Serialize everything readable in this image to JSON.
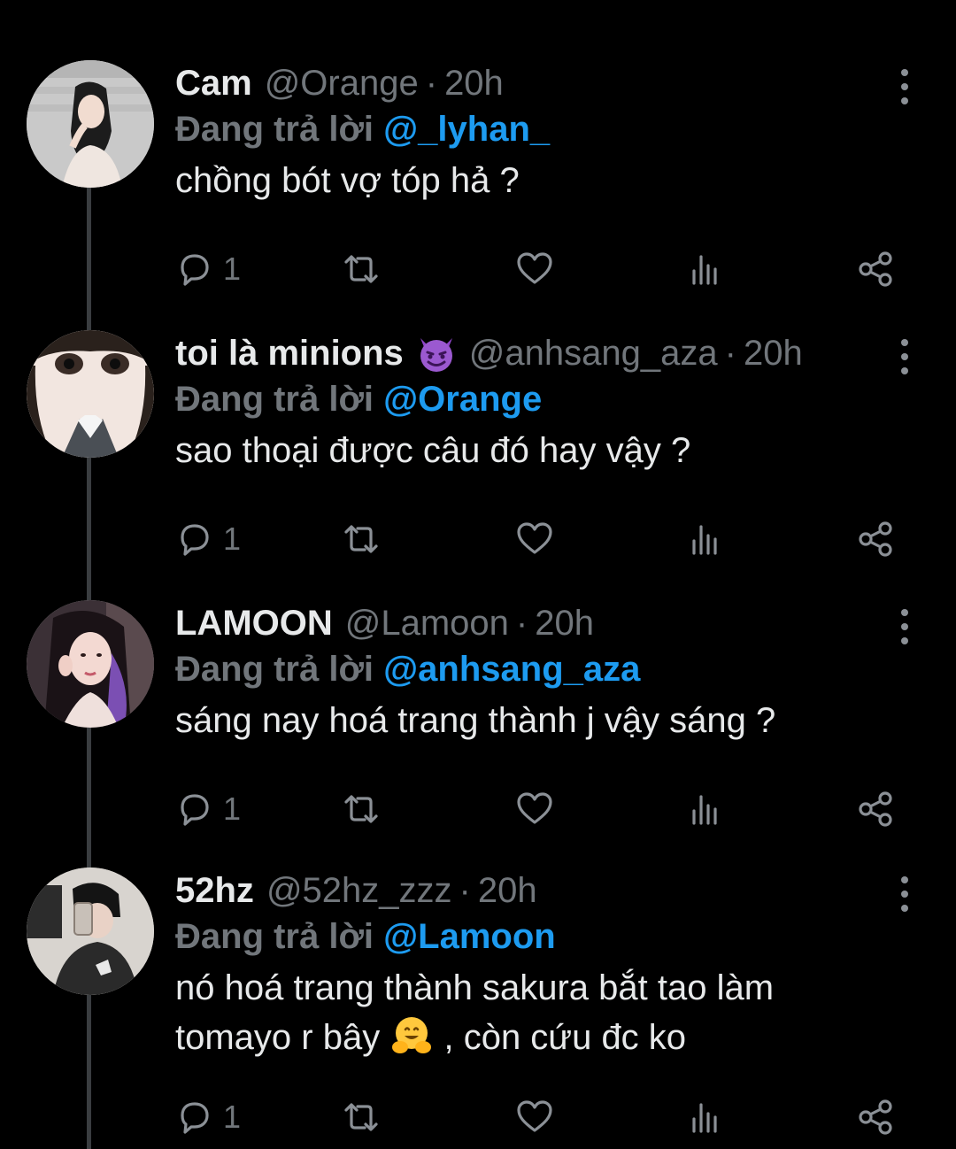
{
  "tweets": [
    {
      "display_name": "Cam",
      "has_emoji": false,
      "handle": "@Orange",
      "separator": "·",
      "time": "20h",
      "replying_label": "Đang trả lời",
      "reply_mention": "@_lyhan_",
      "text": "chồng bót vợ tóp hả ?",
      "reply_count": "1"
    },
    {
      "display_name": "toi là minions",
      "has_emoji": true,
      "emoji_icon": "smiling-imp-icon",
      "handle": "@anhsang_aza",
      "separator": "·",
      "time": "20h",
      "replying_label": "Đang trả lời",
      "reply_mention": "@Orange",
      "text": "sao thoại được câu đó hay vậy ?",
      "reply_count": "1"
    },
    {
      "display_name": "LAMOON",
      "has_emoji": false,
      "handle": "@Lamoon",
      "separator": "·",
      "time": "20h",
      "replying_label": "Đang trả lời",
      "reply_mention": "@anhsang_aza",
      "text": "sáng nay hoá trang thành j vậy sáng ?",
      "reply_count": "1"
    },
    {
      "display_name": "52hz",
      "has_emoji": false,
      "handle": "@52hz_zzz",
      "separator": "·",
      "time": "20h",
      "replying_label": "Đang trả lời",
      "reply_mention": "@Lamoon",
      "text_line1": "nó hoá trang thành sakura bắt tao làm",
      "text_line2_before": "tomayo r bây",
      "text_line2_emoji": "hugging-face-icon",
      "text_line2_after": ", còn cứu đc ko",
      "reply_count": "1"
    }
  ],
  "icons": {
    "reply": "reply-bubble-icon",
    "retweet": "retweet-icon",
    "like": "heart-icon",
    "views": "analytics-bars-icon",
    "share": "share-icon",
    "more": "more-vertical-icon"
  },
  "colors": {
    "background": "#000000",
    "primary_text": "#e7e9ea",
    "secondary_text": "#71767b",
    "mention": "#1d9bf0",
    "thread_line": "#3a3d40"
  }
}
